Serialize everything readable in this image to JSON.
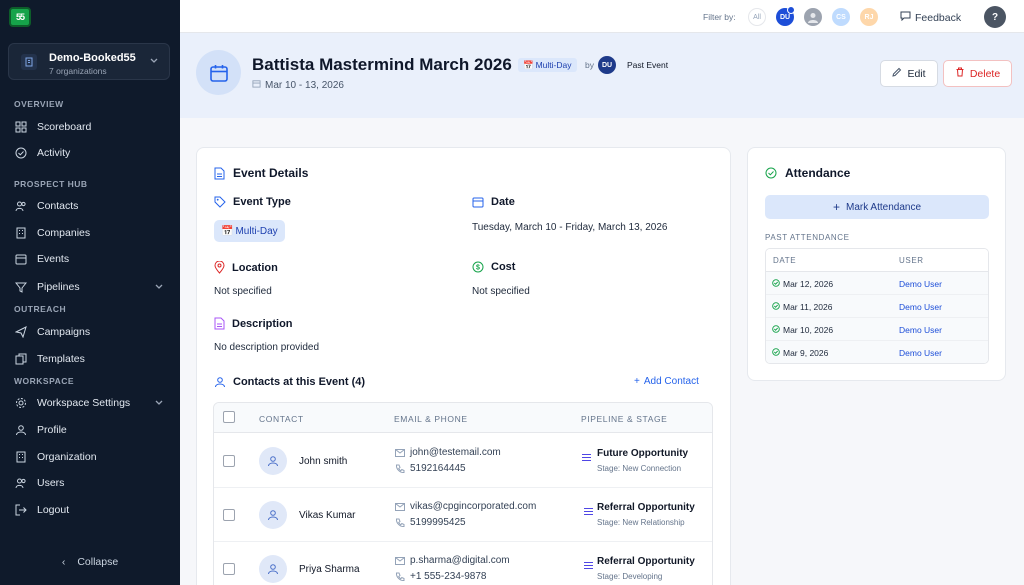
{
  "app": {
    "logo_text": "55"
  },
  "org": {
    "name": "Demo-Booked55",
    "subtitle": "7 organizations"
  },
  "sidebar": {
    "sections": {
      "overview": "OVERVIEW",
      "prospect_hub": "PROSPECT HUB",
      "outreach": "OUTREACH",
      "workspace": "WORKSPACE"
    },
    "items": {
      "scoreboard": "Scoreboard",
      "activity": "Activity",
      "contacts": "Contacts",
      "companies": "Companies",
      "events": "Events",
      "pipelines": "Pipelines",
      "campaigns": "Campaigns",
      "templates": "Templates",
      "workspace_settings": "Workspace Settings",
      "profile": "Profile",
      "organization": "Organization",
      "users": "Users",
      "logout": "Logout"
    },
    "collapse": "Collapse"
  },
  "topbar": {
    "filter_label": "Filter by:",
    "filters": [
      {
        "label": "All",
        "color": "#ffffff"
      },
      {
        "label": "DU",
        "color": "#1d4ed8"
      },
      {
        "label": "",
        "color": "#9ca3af"
      },
      {
        "label": "CS",
        "color": "#bfdbfe"
      },
      {
        "label": "RJ",
        "color": "#fed7aa"
      }
    ],
    "feedback": "Feedback",
    "help": "?"
  },
  "event": {
    "title": "Battista Mastermind March 2026",
    "type_badge": "Multi-Day",
    "by": "by",
    "owner_initials": "DU",
    "status": "Past Event",
    "dates": "Mar 10 - 13, 2026",
    "edit": "Edit",
    "delete": "Delete"
  },
  "details": {
    "title": "Event Details",
    "event_type_label": "Event Type",
    "event_type_value": "Multi-Day",
    "date_label": "Date",
    "date_value": "Tuesday, March 10 - Friday, March 13, 2026",
    "location_label": "Location",
    "location_value": "Not specified",
    "cost_label": "Cost",
    "cost_value": "Not specified",
    "description_label": "Description",
    "description_value": "No description provided"
  },
  "contacts": {
    "title": "Contacts at this Event (4)",
    "add": "Add Contact",
    "headers": {
      "contact": "CONTACT",
      "email_phone": "EMAIL & PHONE",
      "pipeline_stage": "PIPELINE & STAGE"
    },
    "rows": [
      {
        "name": "John smith",
        "email": "john@testemail.com",
        "phone": "5192164445",
        "pipeline": "Future Opportunity",
        "stage": "Stage: New Connection"
      },
      {
        "name": "Vikas Kumar",
        "email": "vikas@cpgincorporated.com",
        "phone": "5199995425",
        "pipeline": "Referral Opportunity",
        "stage": "Stage: New Relationship"
      },
      {
        "name": "Priya Sharma",
        "email": "p.sharma@digital.com",
        "phone": "+1 555-234-9878",
        "pipeline": "Referral Opportunity",
        "stage": "Stage: Developing"
      }
    ]
  },
  "attendance": {
    "title": "Attendance",
    "mark": "Mark Attendance",
    "past_label": "PAST ATTENDANCE",
    "headers": {
      "date": "DATE",
      "user": "USER"
    },
    "rows": [
      {
        "date": "Mar 12, 2026",
        "user": "Demo User"
      },
      {
        "date": "Mar 11, 2026",
        "user": "Demo User"
      },
      {
        "date": "Mar 10, 2026",
        "user": "Demo User"
      },
      {
        "date": "Mar 9, 2026",
        "user": "Demo User"
      }
    ]
  },
  "colors": {
    "accent": "#2563eb",
    "sidebar_bg": "#0f1a2b",
    "danger": "#dc2626",
    "success": "#16a34a"
  }
}
